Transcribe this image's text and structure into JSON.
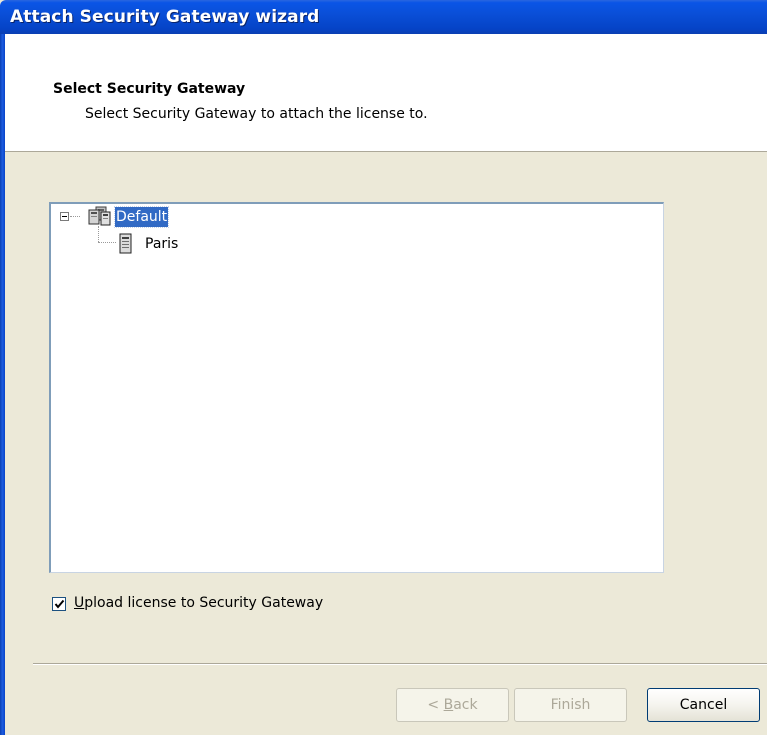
{
  "window": {
    "title": "Attach Security Gateway wizard"
  },
  "header": {
    "title": "Select Security Gateway",
    "subtitle": "Select Security Gateway to attach the license to."
  },
  "tree": {
    "root": {
      "label": "Default",
      "icon": "gateway-group-icon",
      "expanded": true,
      "selected": true
    },
    "children": [
      {
        "label": "Paris",
        "icon": "server-icon"
      }
    ]
  },
  "options": {
    "upload_checked": true,
    "upload_label_prefix": "U",
    "upload_label_rest": "pload license to Security Gateway"
  },
  "buttons": {
    "back_label_prefix": "< ",
    "back_label_mnemonic": "B",
    "back_label_rest": "ack",
    "back_enabled": false,
    "finish_label": "Finish",
    "finish_enabled": false,
    "cancel_label": "Cancel"
  },
  "colors": {
    "titlebar": "#0a4fd8",
    "selection": "#316ac5",
    "dialog_bg": "#ece9d8"
  }
}
